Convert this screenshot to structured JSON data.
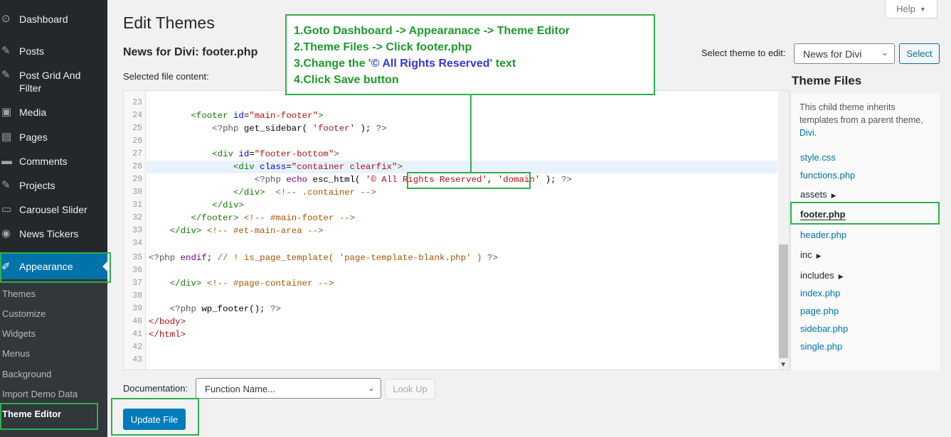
{
  "sidebar": {
    "items": [
      {
        "label": "Dashboard",
        "icon": "dashboard-icon",
        "glyph": "⊙"
      },
      {
        "label": "Posts",
        "icon": "pin-icon",
        "glyph": "✎"
      },
      {
        "label": "Post Grid And Filter",
        "icon": "pin-icon",
        "glyph": "✎"
      },
      {
        "label": "Media",
        "icon": "media-icon",
        "glyph": "▣"
      },
      {
        "label": "Pages",
        "icon": "pages-icon",
        "glyph": "▤"
      },
      {
        "label": "Comments",
        "icon": "comment-icon",
        "glyph": "▬"
      },
      {
        "label": "Projects",
        "icon": "pin-icon",
        "glyph": "✎"
      },
      {
        "label": "Carousel Slider",
        "icon": "slider-icon",
        "glyph": "▭"
      },
      {
        "label": "News Tickers",
        "icon": "ticker-icon",
        "glyph": "◉"
      }
    ],
    "appearance": {
      "label": "Appearance",
      "glyph": "✐"
    },
    "submenu": [
      "Themes",
      "Customize",
      "Widgets",
      "Menus",
      "Background",
      "Import Demo Data",
      "Theme Editor"
    ]
  },
  "header": {
    "title": "Edit Themes",
    "file_title": "News for Divi: footer.php",
    "selected_label": "Selected file content:",
    "help": "Help",
    "help_chevron": "▼",
    "select_theme_label": "Select theme to edit:",
    "theme_value": "News for Divi",
    "select_button": "Select"
  },
  "editor": {
    "active_line": 28,
    "lines": [
      {
        "n": "23",
        "html": ""
      },
      {
        "n": "24",
        "html": "        <span class='t-tag'>&lt;footer</span> <span class='t-attr'>id</span>=<span class='t-str'>\"main-footer\"</span><span class='t-tag'>&gt;</span>"
      },
      {
        "n": "25",
        "html": "            <span class='t-php'>&lt;?php</span> get_sidebar( <span class='t-str'>'footer'</span> ); <span class='t-php'>?&gt;</span>"
      },
      {
        "n": "26",
        "html": ""
      },
      {
        "n": "27",
        "html": "            <span class='t-tag'>&lt;div</span> <span class='t-attr'>id</span>=<span class='t-str'>\"footer-bottom\"</span><span class='t-tag'>&gt;</span>"
      },
      {
        "n": "28",
        "html": "                <span class='t-tag'>&lt;div</span> <span class='t-attr'>class</span>=<span class='t-str'>\"container clearfix\"</span><span class='t-tag'>&gt;</span>"
      },
      {
        "n": "29",
        "html": "                    <span class='t-php'>&lt;?php</span> <span class='t-kw'>echo</span> esc_html( <span class='t-str'>'© All Rights Reserved'</span>, <span class='t-str'>'domain'</span> ); <span class='t-php'>?&gt;</span>"
      },
      {
        "n": "30",
        "html": "                <span class='t-tag'>&lt;/div&gt;</span>  <span class='t-cm'>&lt;!-- .container --&gt;</span>"
      },
      {
        "n": "31",
        "html": "            <span class='t-tag'>&lt;/div&gt;</span>"
      },
      {
        "n": "32",
        "html": "        <span class='t-tag'>&lt;/footer&gt;</span> <span class='t-cm'>&lt;!-- #main-footer --&gt;</span>"
      },
      {
        "n": "33",
        "html": "    <span class='t-tag'>&lt;/div&gt;</span> <span class='t-cm'>&lt;!-- #et-main-area --&gt;</span>"
      },
      {
        "n": "34",
        "html": ""
      },
      {
        "n": "35",
        "html": "<span class='t-php'>&lt;?php</span> <span class='t-kw'>endif</span>; <span class='t-cm'>// ! is_page_template( 'page-template-blank.php' )</span> <span class='t-php'>?&gt;</span>"
      },
      {
        "n": "36",
        "html": ""
      },
      {
        "n": "37",
        "html": "    <span class='t-tag'>&lt;/div&gt;</span> <span class='t-cm'>&lt;!-- #page-container --&gt;</span>"
      },
      {
        "n": "38",
        "html": ""
      },
      {
        "n": "39",
        "html": "    <span class='t-php'>&lt;?php</span> wp_footer(); <span class='t-php'>?&gt;</span>"
      },
      {
        "n": "40",
        "html": "<span class='t-red'>&lt;/body&gt;</span>"
      },
      {
        "n": "41",
        "html": "<span class='t-red'>&lt;/html&gt;</span>"
      },
      {
        "n": "42",
        "html": ""
      },
      {
        "n": "43",
        "html": ""
      }
    ]
  },
  "theme_files": {
    "title": "Theme Files",
    "desc_prefix": "This child theme inherits templates from a parent theme, ",
    "desc_link": "Divi",
    "desc_suffix": ".",
    "items": [
      {
        "label": "style.css",
        "type": "file"
      },
      {
        "label": "functions.php",
        "type": "file"
      },
      {
        "label": "assets",
        "type": "dir"
      },
      {
        "label": "footer.php",
        "type": "active"
      },
      {
        "label": "header.php",
        "type": "file"
      },
      {
        "label": "inc",
        "type": "dir"
      },
      {
        "label": "includes",
        "type": "dir"
      },
      {
        "label": "index.php",
        "type": "file"
      },
      {
        "label": "page.php",
        "type": "file"
      },
      {
        "label": "sidebar.php",
        "type": "file"
      },
      {
        "label": "single.php",
        "type": "file"
      }
    ]
  },
  "bottom": {
    "doc_label": "Documentation:",
    "doc_select": "Function Name...",
    "lookup": "Look Up",
    "update": "Update File"
  },
  "annotation": {
    "line1": "1.Goto Dashboard -> Appearanace -> Theme Editor",
    "line2": "2.Theme Files -> Click footer.php",
    "line3_pre": "3.Change the '",
    "line3_hl": "© All Rights Reserved",
    "line3_post": "' text",
    "line4": "4.Click Save button"
  },
  "colors": {
    "accent": "#0073aa",
    "annotation": "#2eb04b",
    "sidebar": "#23282d"
  }
}
